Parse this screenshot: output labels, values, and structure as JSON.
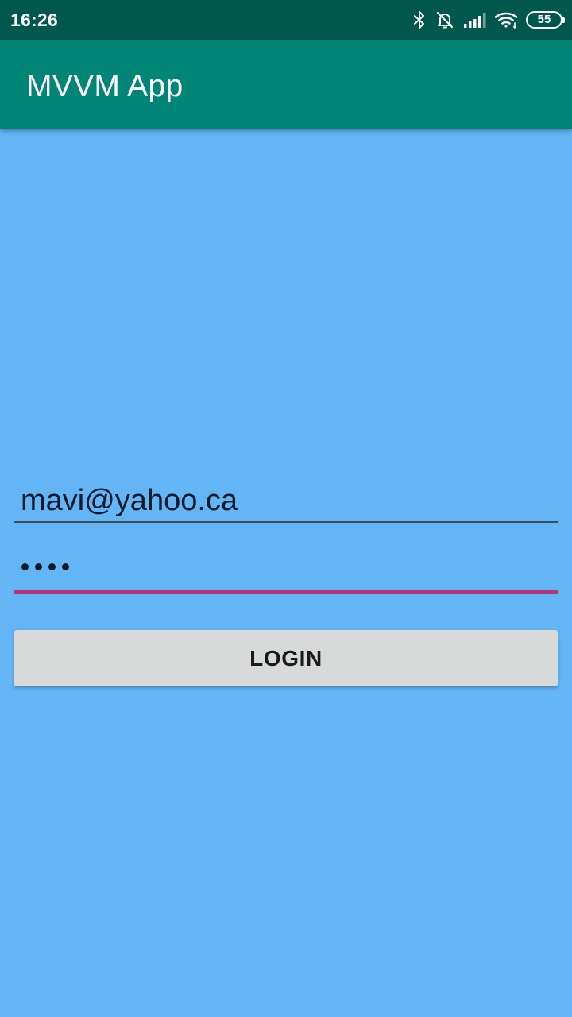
{
  "status_bar": {
    "time": "16:26",
    "battery_level": "55",
    "icons": [
      "bluetooth-icon",
      "alarm-off-icon",
      "signal-icon",
      "wifi-icon",
      "battery-icon"
    ]
  },
  "app_bar": {
    "title": "MVVM App"
  },
  "form": {
    "email_value": "mavi@yahoo.ca",
    "password_mask_length": 4,
    "login_label": "LOGIN"
  },
  "colors": {
    "status_bar": "#00574b",
    "app_bar": "#008577",
    "background": "#64b5f6",
    "accent": "#b7347c",
    "button": "#d8d9d9"
  }
}
